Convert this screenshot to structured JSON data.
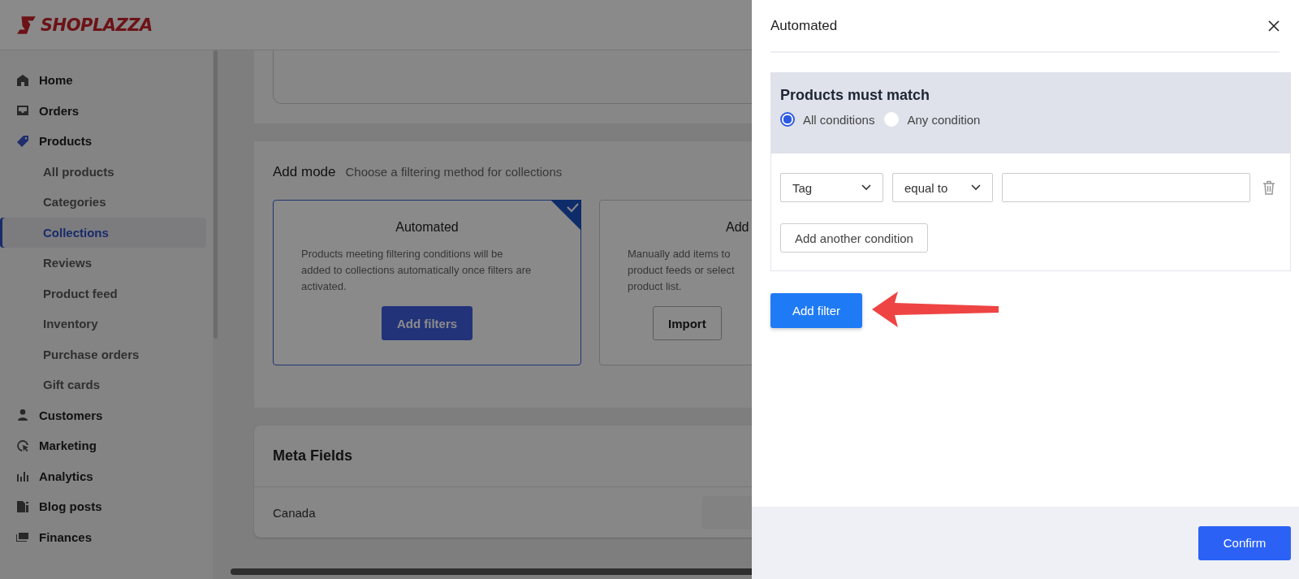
{
  "brand": {
    "name": "SHOPLAZZA"
  },
  "sidebar": {
    "items": [
      {
        "label": "Home",
        "selected": false
      },
      {
        "label": "Orders",
        "selected": false
      },
      {
        "label": "Products",
        "selected": false,
        "children": [
          {
            "label": "All products",
            "selected": false
          },
          {
            "label": "Categories",
            "selected": false
          },
          {
            "label": "Collections",
            "selected": true
          },
          {
            "label": "Reviews",
            "selected": false
          },
          {
            "label": "Product feed",
            "selected": false
          },
          {
            "label": "Inventory",
            "selected": false
          },
          {
            "label": "Purchase orders",
            "selected": false
          },
          {
            "label": "Gift cards",
            "selected": false
          }
        ]
      },
      {
        "label": "Customers",
        "selected": false
      },
      {
        "label": "Marketing",
        "selected": false
      },
      {
        "label": "Analytics",
        "selected": false
      },
      {
        "label": "Blog posts",
        "selected": false
      },
      {
        "label": "Finances",
        "selected": false
      }
    ]
  },
  "add_mode": {
    "title": "Add mode",
    "subtitle": "Choose a filtering method for collections",
    "options": [
      {
        "title": "Automated",
        "description_lines": [
          "Products meeting filtering conditions will be",
          "added to collections automatically once filters are",
          "activated."
        ],
        "button": "Add filters",
        "selected": true
      },
      {
        "title": "Add",
        "description_lines": [
          "Manually add items to",
          "product feeds or select",
          "product list."
        ],
        "button": "Import",
        "selected": false
      }
    ]
  },
  "meta_fields": {
    "title": "Meta Fields",
    "rows": [
      {
        "label": "Canada"
      }
    ]
  },
  "drawer": {
    "title": "Automated",
    "match": {
      "title": "Products must match",
      "options": [
        {
          "label": "All conditions",
          "selected": true
        },
        {
          "label": "Any condition",
          "selected": false
        }
      ]
    },
    "conditions": [
      {
        "field": "Tag",
        "operator": "equal to"
      }
    ],
    "add_condition_button": "Add another condition",
    "add_filter_button": "Add filter",
    "confirm_button": "Confirm"
  }
}
